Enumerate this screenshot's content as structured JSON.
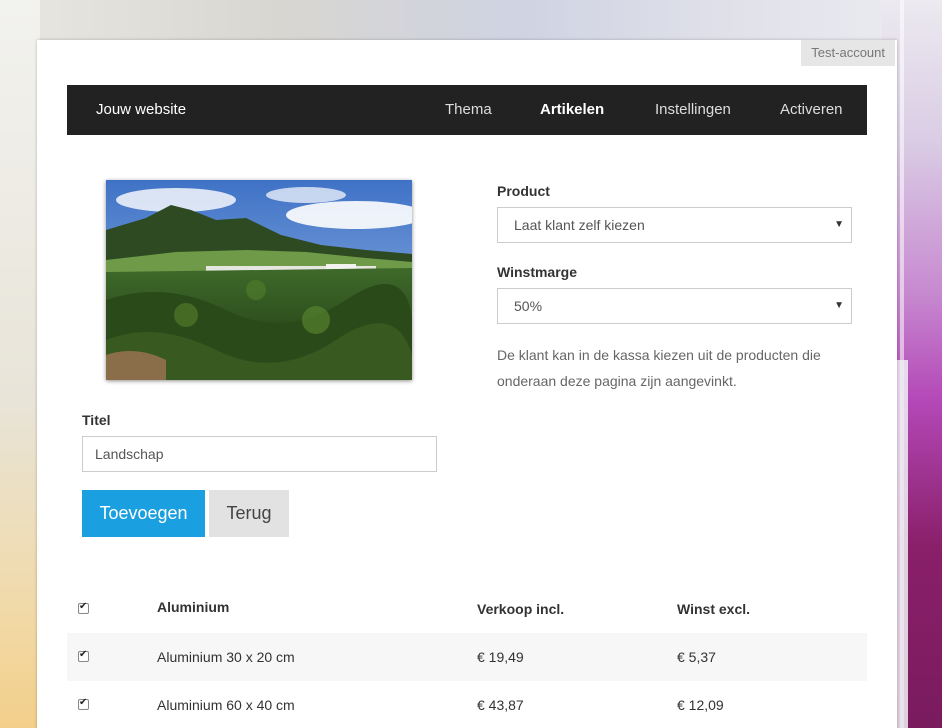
{
  "account_badge": "Test-account",
  "nav": {
    "brand": "Jouw website",
    "items": [
      {
        "label": "Thema",
        "active": false
      },
      {
        "label": "Artikelen",
        "active": true
      },
      {
        "label": "Instellingen",
        "active": false
      },
      {
        "label": "Activeren",
        "active": false
      }
    ]
  },
  "image": {
    "icon": "landscape-photo"
  },
  "form": {
    "title_label": "Titel",
    "title_value": "Landschap",
    "product_label": "Product",
    "product_selected": "Laat klant zelf kiezen",
    "margin_label": "Winstmarge",
    "margin_selected": "50%",
    "help_text": "De klant kan in de kassa kiezen uit de producten die onderaan deze pagina zijn aangevinkt.",
    "add_button": "Toevoegen",
    "back_button": "Terug"
  },
  "table": {
    "headers": {
      "name": "Aluminium",
      "sale": "Verkoop incl.",
      "profit": "Winst excl."
    },
    "header_checked": true,
    "rows": [
      {
        "checked": true,
        "name": "Aluminium 30 x 20 cm",
        "sale": "€ 19,49",
        "profit": "€ 5,37"
      },
      {
        "checked": true,
        "name": "Aluminium 60 x 40 cm",
        "sale": "€ 43,87",
        "profit": "€ 12,09"
      }
    ]
  },
  "colors": {
    "navbar": "#222222",
    "primary_button": "#1a9fe0",
    "default_button": "#e2e2e2"
  }
}
